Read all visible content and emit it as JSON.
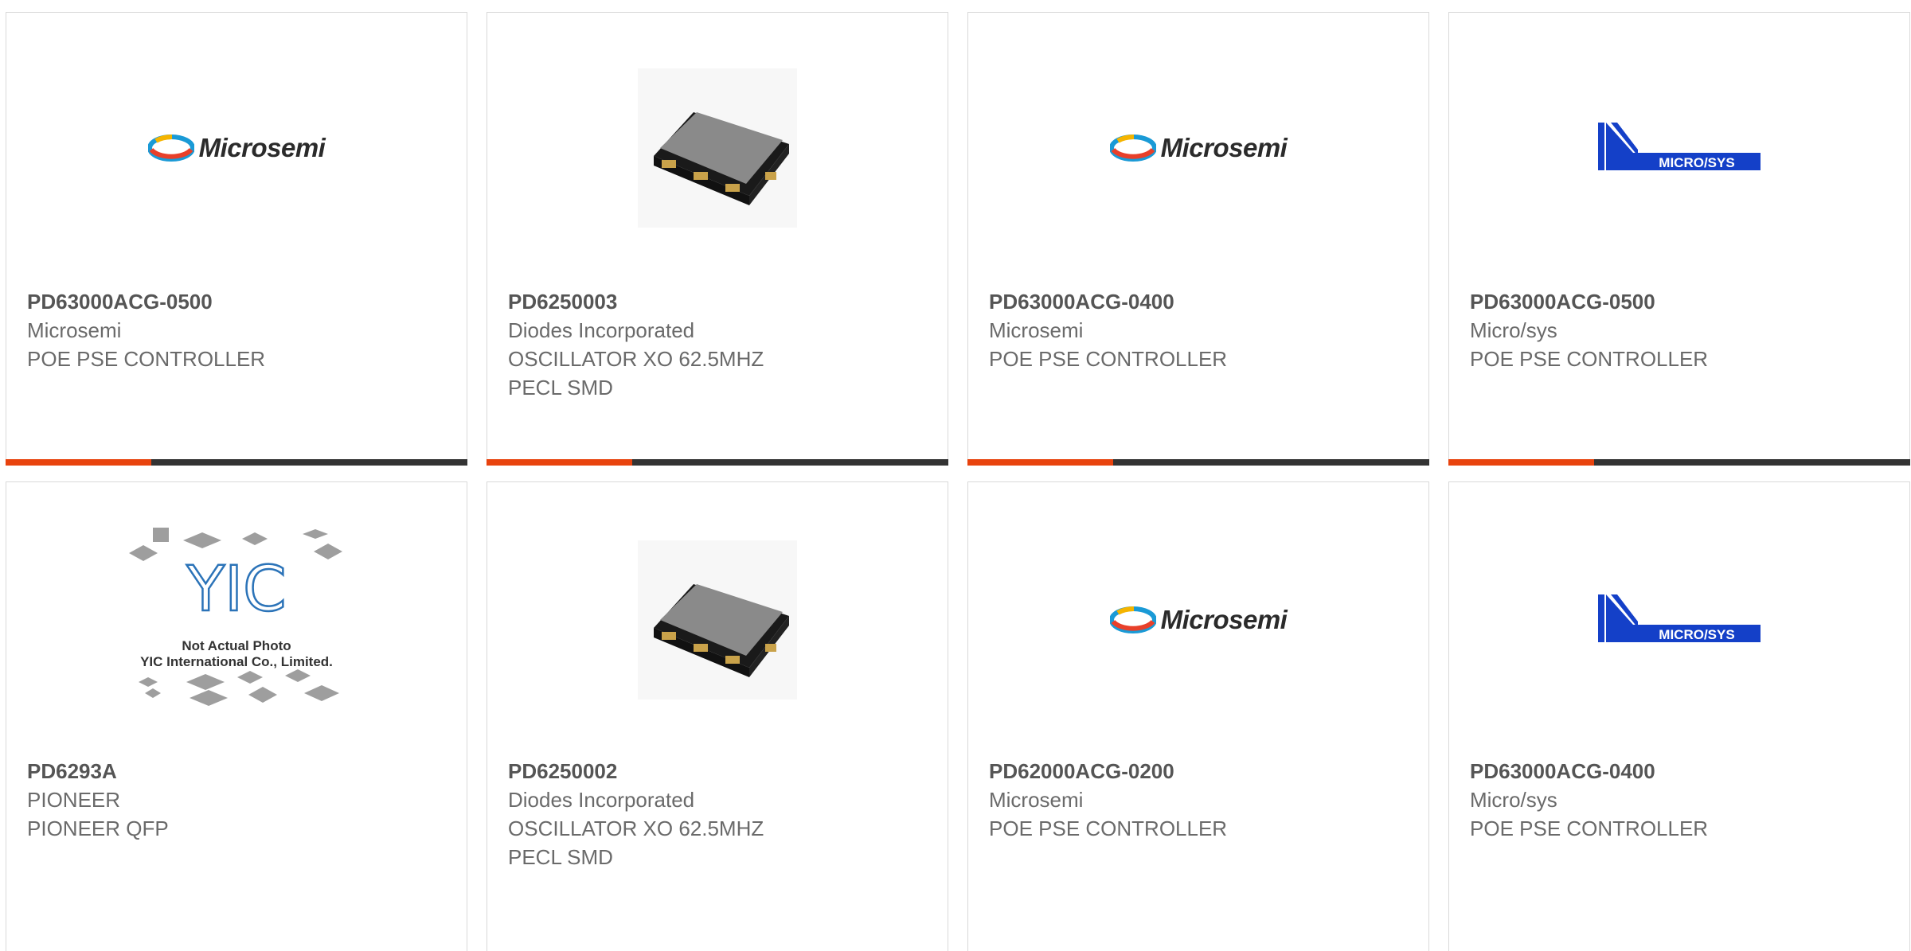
{
  "products": [
    {
      "part_number": "PD63000ACG-0500",
      "manufacturer": "Microsemi",
      "description": "POE PSE CONTROLLER",
      "image": "microsemi-logo"
    },
    {
      "part_number": "PD6250003",
      "manufacturer": "Diodes Incorporated",
      "description": "OSCILLATOR XO 62.5MHZ\nPECL SMD",
      "image": "oscillator-chip"
    },
    {
      "part_number": "PD63000ACG-0400",
      "manufacturer": "Microsemi",
      "description": "POE PSE CONTROLLER",
      "image": "microsemi-logo"
    },
    {
      "part_number": "PD63000ACG-0500",
      "manufacturer": "Micro/sys",
      "description": "POE PSE CONTROLLER",
      "image": "microsys-logo"
    },
    {
      "part_number": "PD6293A",
      "manufacturer": "PIONEER",
      "description": "PIONEER QFP",
      "image": "yic-placeholder"
    },
    {
      "part_number": "PD6250002",
      "manufacturer": "Diodes Incorporated",
      "description": "OSCILLATOR XO 62.5MHZ\nPECL SMD",
      "image": "oscillator-chip"
    },
    {
      "part_number": "PD62000ACG-0200",
      "manufacturer": "Microsemi",
      "description": "POE PSE CONTROLLER",
      "image": "microsemi-logo"
    },
    {
      "part_number": "PD63000ACG-0400",
      "manufacturer": "Micro/sys",
      "description": "POE PSE CONTROLLER",
      "image": "microsys-logo"
    }
  ],
  "logos": {
    "microsemi": "Microsemi",
    "microsys": "MICRO/SYS",
    "yic_line1": "Not Actual Photo",
    "yic_line2": "YIC International Co., Limited."
  },
  "colors": {
    "accent": "#e8430e",
    "bar": "#333333",
    "border": "#d9d9d9",
    "text": "#6a6a6a"
  }
}
